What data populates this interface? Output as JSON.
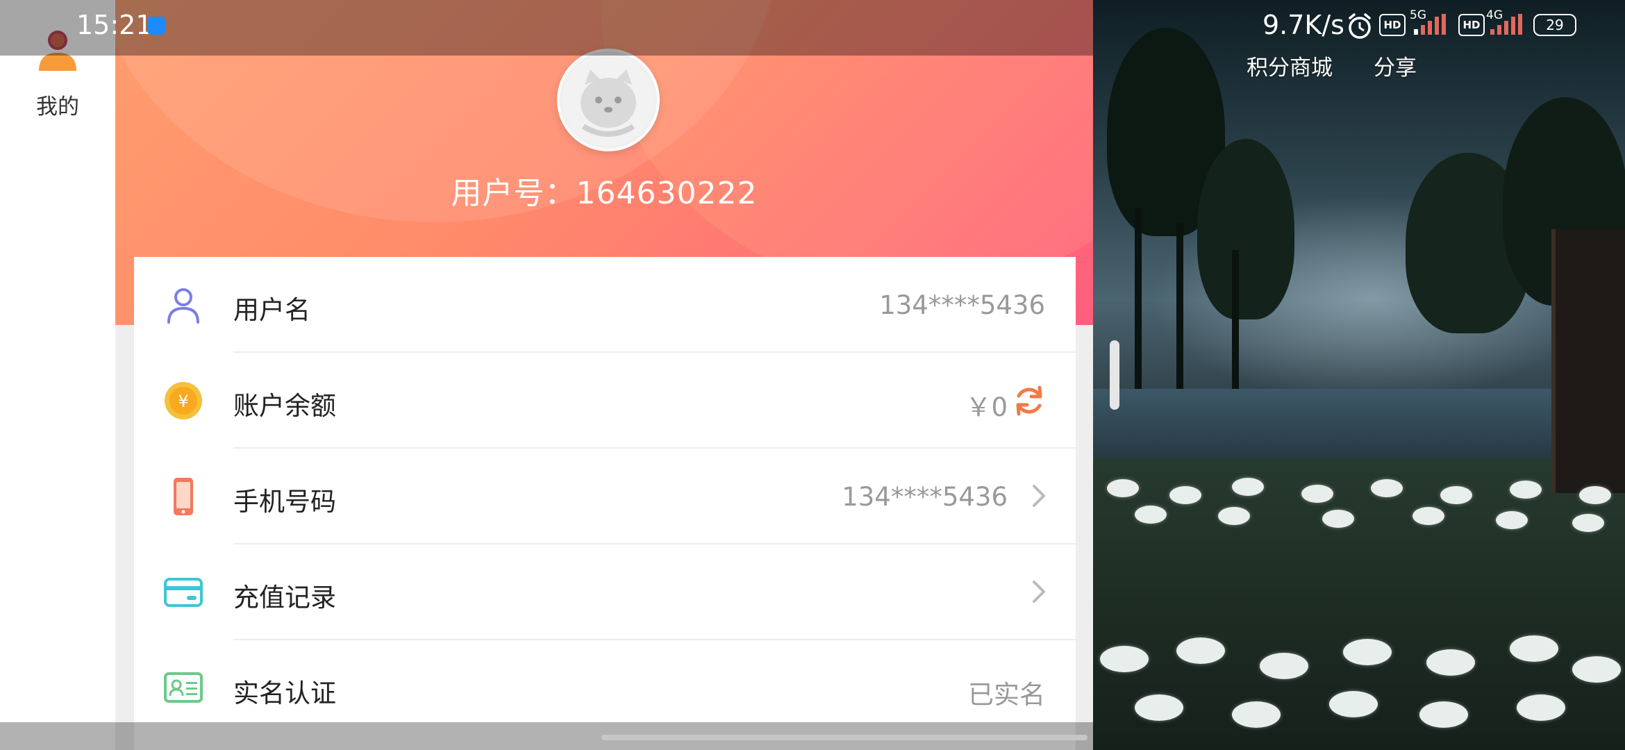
{
  "status_bar": {
    "time": "15:21",
    "net_speed": "9.7K/s",
    "sim1": {
      "hd": "HD",
      "net": "5G"
    },
    "sim2": {
      "hd": "HD",
      "net": "4G"
    },
    "battery": "29"
  },
  "left_nav": {
    "items": [
      {
        "label": "我的",
        "icon": "user-icon"
      }
    ]
  },
  "profile": {
    "user_id_text": "用户号：164630222",
    "avatar": "cat-avatar-icon"
  },
  "info_list": [
    {
      "label": "用户名",
      "value": "134****5436",
      "icon": "user-outline-icon",
      "trailing": "none"
    },
    {
      "label": "账户余额",
      "value": "￥0",
      "icon": "coin-icon",
      "trailing": "refresh-icon"
    },
    {
      "label": "手机号码",
      "value": "134****5436",
      "icon": "phone-icon",
      "trailing": "chevron-right-icon"
    },
    {
      "label": "充值记录",
      "value": "",
      "icon": "card-icon",
      "trailing": "chevron-right-icon"
    },
    {
      "label": "实名认证",
      "value": "已实名",
      "icon": "id-card-icon",
      "trailing": "none"
    }
  ],
  "game_overlay": {
    "links": [
      "积分商城",
      "分享"
    ]
  },
  "colors": {
    "hero_start": "#ff9d6e",
    "hero_end": "#ff5e7c",
    "accent_orange": "#f07a48",
    "user_icon": "#7b7fe0",
    "coin": "#f5c13a",
    "phone": "#f07a5a",
    "card": "#3ec6d6",
    "id_card": "#6cc98a"
  }
}
